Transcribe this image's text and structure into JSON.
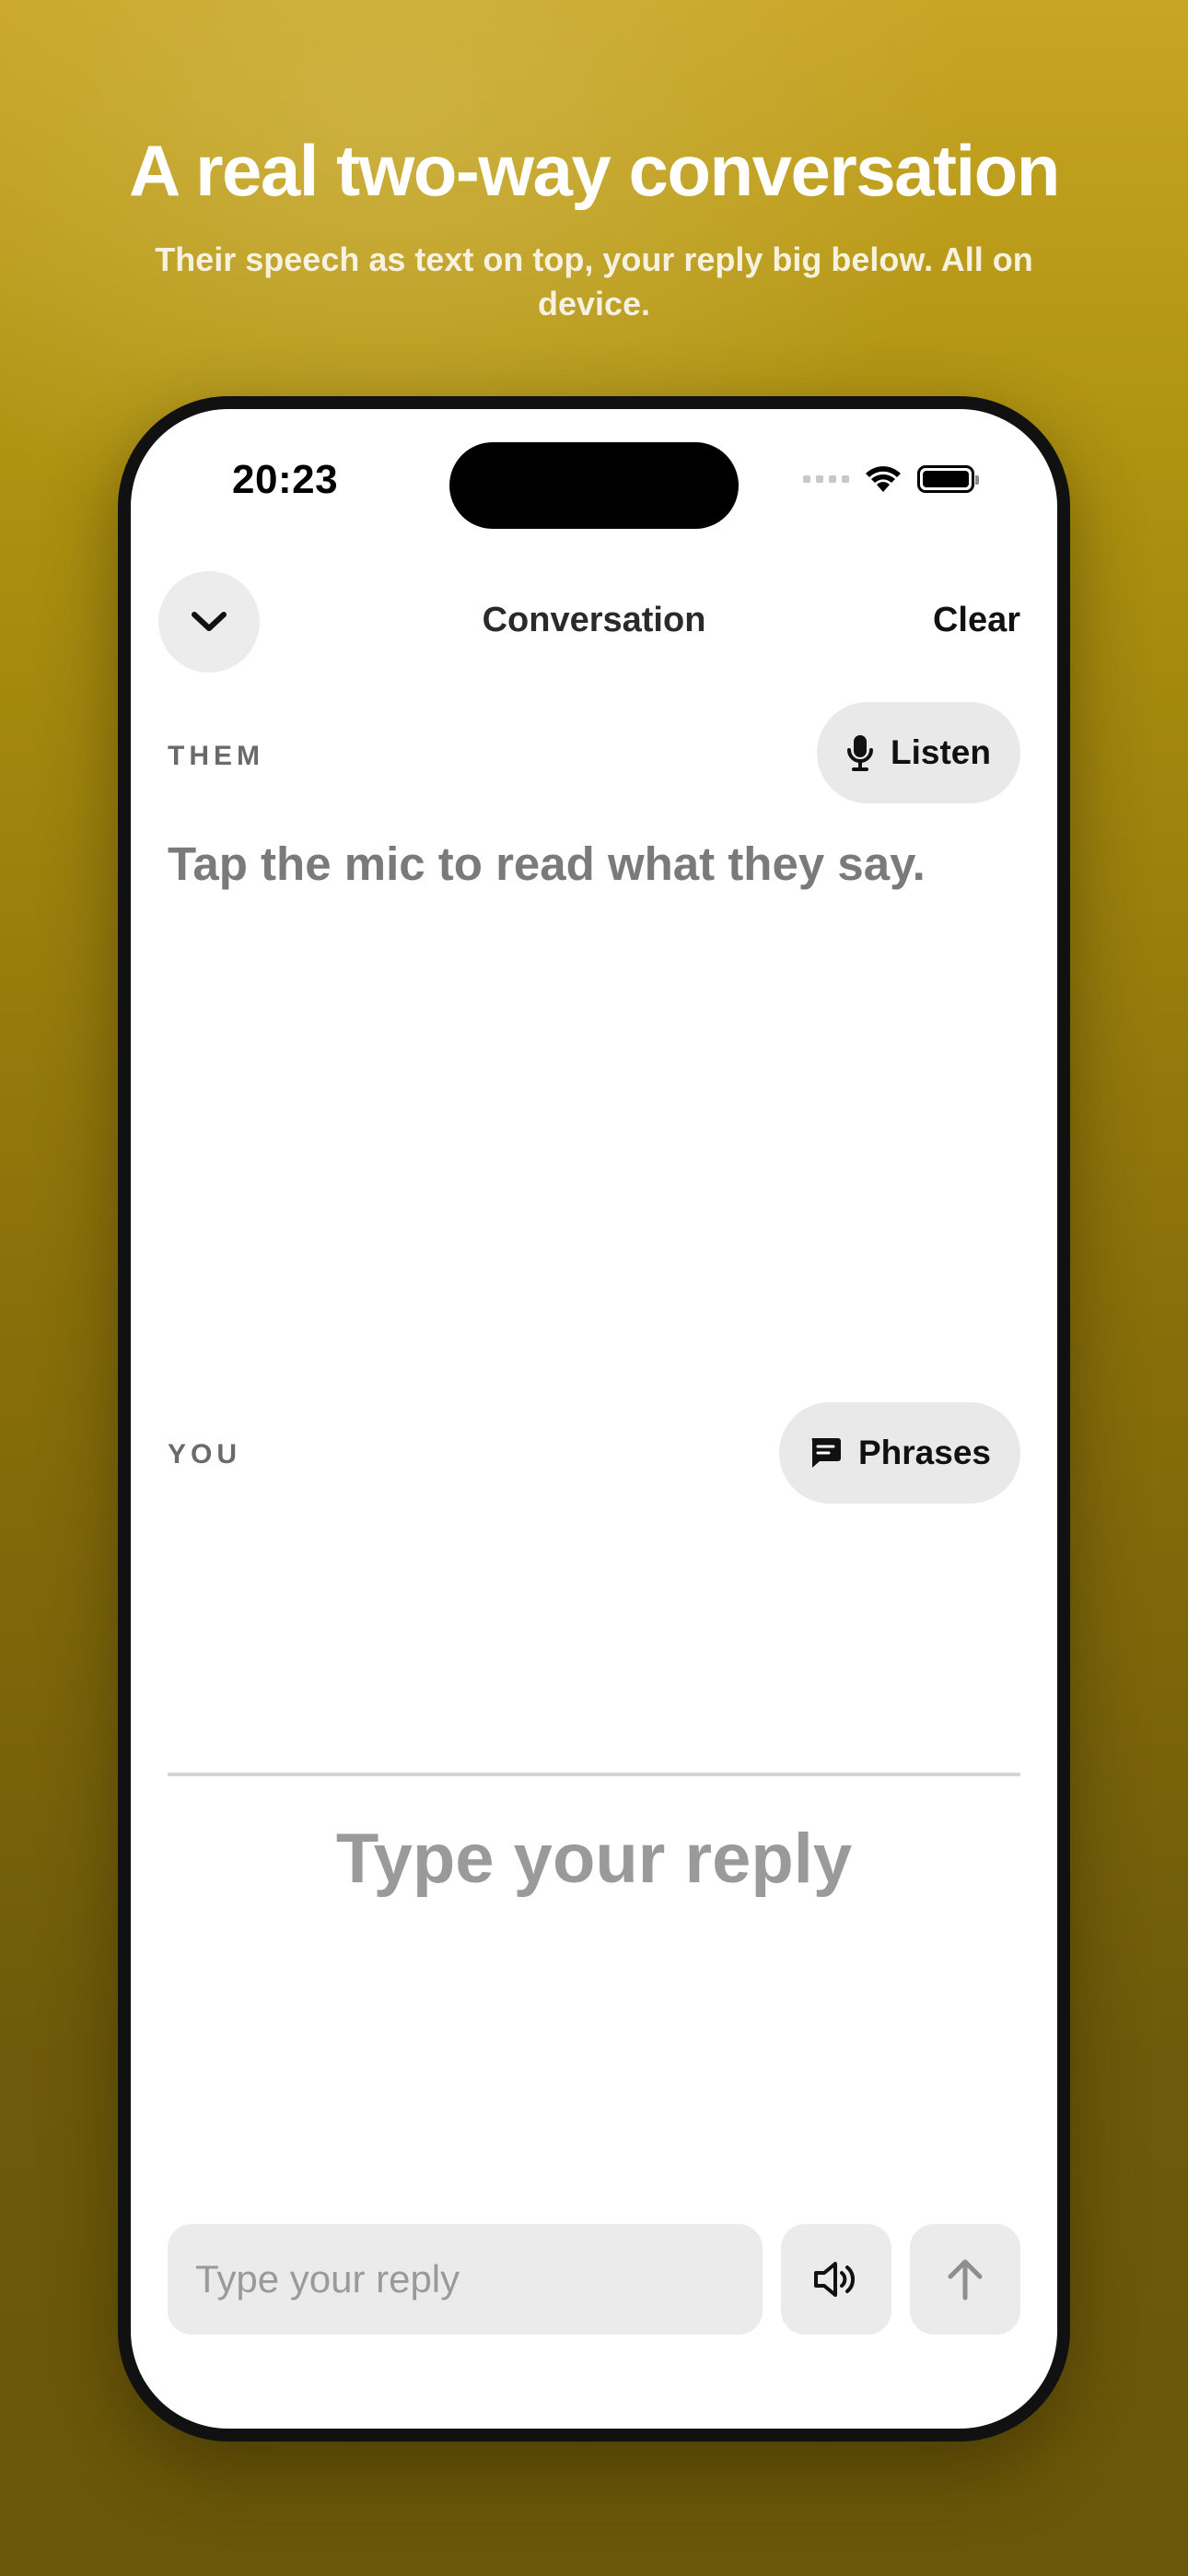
{
  "promo": {
    "headline": "A real two-way conversation",
    "subheadline": "Their speech as text on top, your reply big below. All on device."
  },
  "status_bar": {
    "time": "20:23",
    "icons": [
      "signal-dots-icon",
      "wifi-icon",
      "battery-icon"
    ]
  },
  "nav": {
    "back_icon": "chevron-down-icon",
    "title": "Conversation",
    "clear_label": "Clear"
  },
  "them": {
    "label": "THEM",
    "listen_label": "Listen",
    "listen_icon": "mic-icon",
    "prompt": "Tap the mic to read what they say."
  },
  "you": {
    "label": "YOU",
    "phrases_label": "Phrases",
    "phrases_icon": "chat-bubble-icon",
    "reply_placeholder": "Type your reply"
  },
  "composer": {
    "placeholder": "Type your reply",
    "speak_icon": "speaker-icon",
    "send_icon": "arrow-up-icon"
  },
  "colors": {
    "background_top": "#c8a525",
    "background_bottom": "#6a5709",
    "accent_gray": "#e9e9e9"
  }
}
